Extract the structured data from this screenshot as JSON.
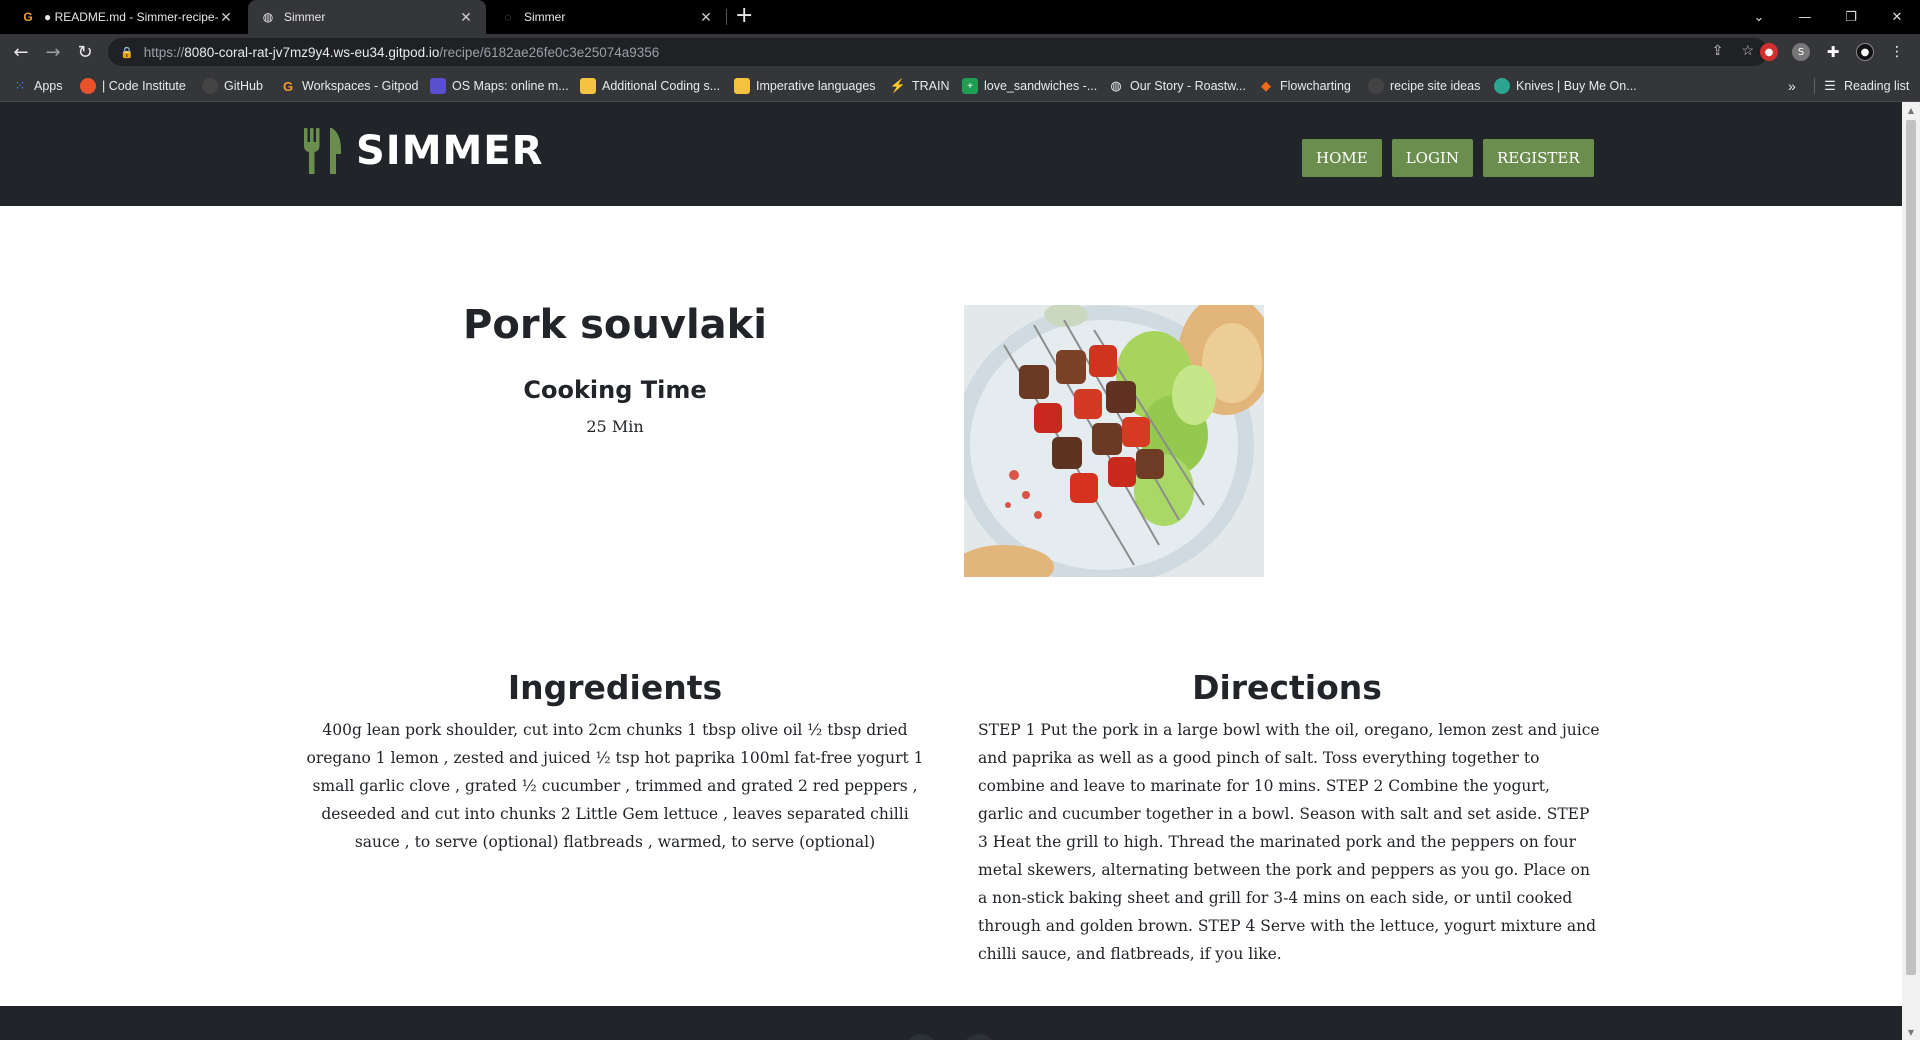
{
  "browser": {
    "tabs": [
      {
        "title": "● README.md - Simmer-recipe-",
        "icon": "gitpod-icon"
      },
      {
        "title": "Simmer",
        "icon": "globe-icon"
      },
      {
        "title": "Simmer",
        "icon": "loading-icon"
      }
    ],
    "url": {
      "scheme": "https://",
      "host": "8080-coral-rat-jv7mz9y4.ws-eu34.gitpod.io",
      "path": "/recipe/6182ae26fe0c3e25074a9356"
    },
    "bookmarks": [
      {
        "label": "Apps",
        "icon": "apps-grid-icon",
        "color": "#e8eaed"
      },
      {
        "label": "| Code Institute",
        "icon": "code-institute-icon",
        "color": "#e8532b"
      },
      {
        "label": "GitHub",
        "icon": "github-icon",
        "color": "#444"
      },
      {
        "label": "Workspaces - Gitpod",
        "icon": "gitpod-icon",
        "color": "#f29b30"
      },
      {
        "label": "OS Maps: online m...",
        "icon": "os-maps-icon",
        "color": "#5a4fcf"
      },
      {
        "label": "Additional Coding s...",
        "icon": "folder-icon",
        "color": "#f5c242"
      },
      {
        "label": "Imperative languages",
        "icon": "folder-icon",
        "color": "#f5c242"
      },
      {
        "label": "TRAIN",
        "icon": "train-icon",
        "color": "#4a7fe0"
      },
      {
        "label": "love_sandwiches -...",
        "icon": "sheets-icon",
        "color": "#1e9e52"
      },
      {
        "label": "Our Story - Roastw...",
        "icon": "globe-icon",
        "color": "#e8eaed"
      },
      {
        "label": "Flowcharting",
        "icon": "flowchart-icon",
        "color": "#f26b1d"
      },
      {
        "label": "recipe site ideas",
        "icon": "github-icon",
        "color": "#444"
      },
      {
        "label": "Knives | Buy Me On...",
        "icon": "knives-icon",
        "color": "#2aa58f"
      }
    ],
    "reading_list": "Reading list"
  },
  "site": {
    "brand": "SIMMER",
    "nav": [
      "HOME",
      "LOGIN",
      "REGISTER"
    ],
    "accent_color": "#6b8e4e",
    "header_color": "#212529"
  },
  "recipe": {
    "title": "Pork souvlaki",
    "cooking_time_label": "Cooking Time",
    "cooking_time": "25 Min",
    "ingredients_heading": "Ingredients",
    "ingredients": "400g lean pork shoulder, cut into 2cm chunks 1 tbsp olive oil ½ tbsp dried oregano 1 lemon , zested and juiced ½ tsp hot paprika 100ml fat-free yogurt 1 small garlic clove , grated ½ cucumber , trimmed and grated 2 red peppers , deseeded and cut into chunks 2 Little Gem lettuce , leaves separated chilli sauce , to serve (optional) flatbreads , warmed, to serve (optional)",
    "directions_heading": "Directions",
    "directions": "STEP 1 Put the pork in a large bowl with the oil, oregano, lemon zest and juice and paprika as well as a good pinch of salt. Toss everything together to combine and leave to marinate for 10 mins. STEP 2 Combine the yogurt, garlic and cucumber together in a bowl. Season with salt and set aside. STEP 3 Heat the grill to high. Thread the marinated pork and the peppers on four metal skewers, alternating between the pork and peppers as you go. Place on a non-stick baking sheet and grill for 3-4 mins on each side, or until cooked through and golden brown. STEP 4 Serve with the lettuce, yogurt mixture and chilli sauce, and flatbreads, if you like."
  }
}
